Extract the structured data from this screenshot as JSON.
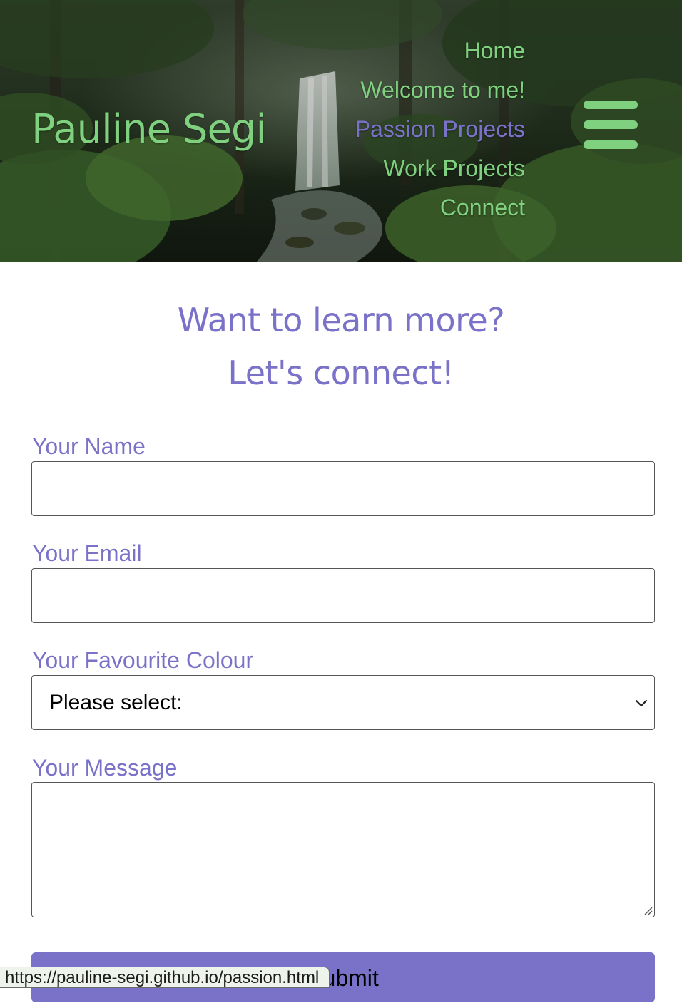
{
  "colors": {
    "brand_green": "#7fd07f",
    "brand_purple": "#7a72c8",
    "active_nav": "#7a72c8"
  },
  "header": {
    "site_title": "Pauline Segi",
    "nav": [
      {
        "label": "Home",
        "active": false
      },
      {
        "label": "Welcome to me!",
        "active": false
      },
      {
        "label": "Passion Projects",
        "active": true
      },
      {
        "label": "Work Projects",
        "active": false
      },
      {
        "label": "Connect",
        "active": false
      }
    ],
    "menu_icon": "hamburger-menu-icon"
  },
  "connect": {
    "heading_line1": "Want to learn more?",
    "heading_line2": "Let's connect!"
  },
  "form": {
    "name_label": "Your Name",
    "name_value": "",
    "email_label": "Your Email",
    "email_value": "",
    "colour_label": "Your Favourite Colour",
    "colour_selected": "Please select:",
    "message_label": "Your Message",
    "message_value": "",
    "submit_label": "Submit"
  },
  "status_bar": {
    "url": "https://pauline-segi.github.io/passion.html"
  }
}
